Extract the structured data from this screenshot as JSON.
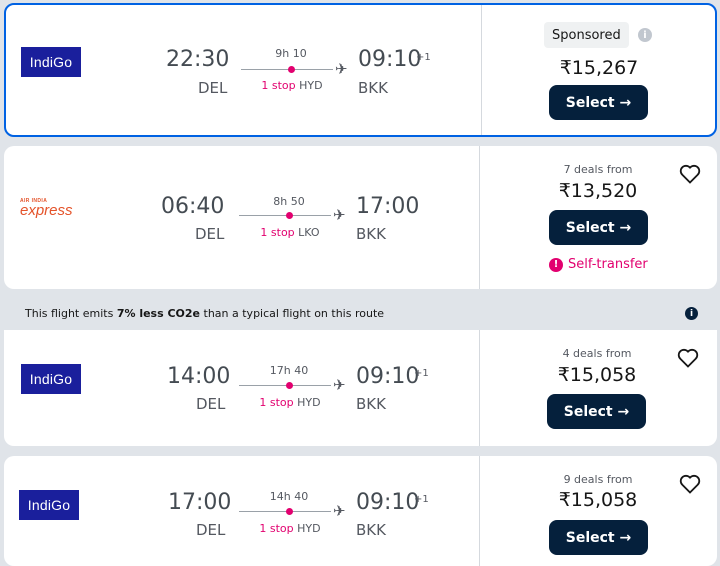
{
  "results": [
    {
      "airline": "IndiGo",
      "logo_type": "indigo",
      "sponsored": true,
      "sponsored_label": "Sponsored",
      "depart_time": "22:30",
      "depart_code": "DEL",
      "arrive_time": "09:10",
      "arrive_plus": "+1",
      "arrive_code": "BKK",
      "duration": "9h 10",
      "stops": "1 stop",
      "via": "HYD",
      "deals": "",
      "price": "₹15,267",
      "select_label": "Select →"
    },
    {
      "airline": "Air India Express",
      "logo_top": "AIR INDIA",
      "logo_main": "express",
      "logo_type": "aix",
      "sponsored": false,
      "depart_time": "06:40",
      "depart_code": "DEL",
      "arrive_time": "17:00",
      "arrive_plus": "",
      "arrive_code": "BKK",
      "duration": "8h 50",
      "stops": "1 stop",
      "via": "LKO",
      "deals": "7 deals from",
      "price": "₹13,520",
      "select_label": "Select →",
      "warning": "Self-transfer"
    },
    {
      "airline": "IndiGo",
      "logo_type": "indigo",
      "sponsored": false,
      "depart_time": "14:00",
      "depart_code": "DEL",
      "arrive_time": "09:10",
      "arrive_plus": "+1",
      "arrive_code": "BKK",
      "duration": "17h 40",
      "stops": "1 stop",
      "via": "HYD",
      "deals": "4 deals from",
      "price": "₹15,058",
      "select_label": "Select →"
    },
    {
      "airline": "IndiGo",
      "logo_type": "indigo",
      "sponsored": false,
      "depart_time": "17:00",
      "depart_code": "DEL",
      "arrive_time": "09:10",
      "arrive_plus": "+1",
      "arrive_code": "BKK",
      "duration": "14h 40",
      "stops": "1 stop",
      "via": "HYD",
      "deals": "9 deals from",
      "price": "₹15,058",
      "select_label": "Select →"
    }
  ],
  "eco_banner": {
    "prefix": "This flight emits ",
    "highlight": "7% less CO2e",
    "suffix": " than a typical flight on this route"
  },
  "colors": {
    "accent_blue": "#0062e3",
    "button_navy": "#05203c",
    "stop_pink": "#e2006f",
    "indigo_brand": "#1a1f9c",
    "aix_brand": "#e4532a"
  },
  "icons": {
    "plane": "plane-icon",
    "heart": "heart-icon",
    "info": "info-icon",
    "warning": "warning-icon"
  }
}
